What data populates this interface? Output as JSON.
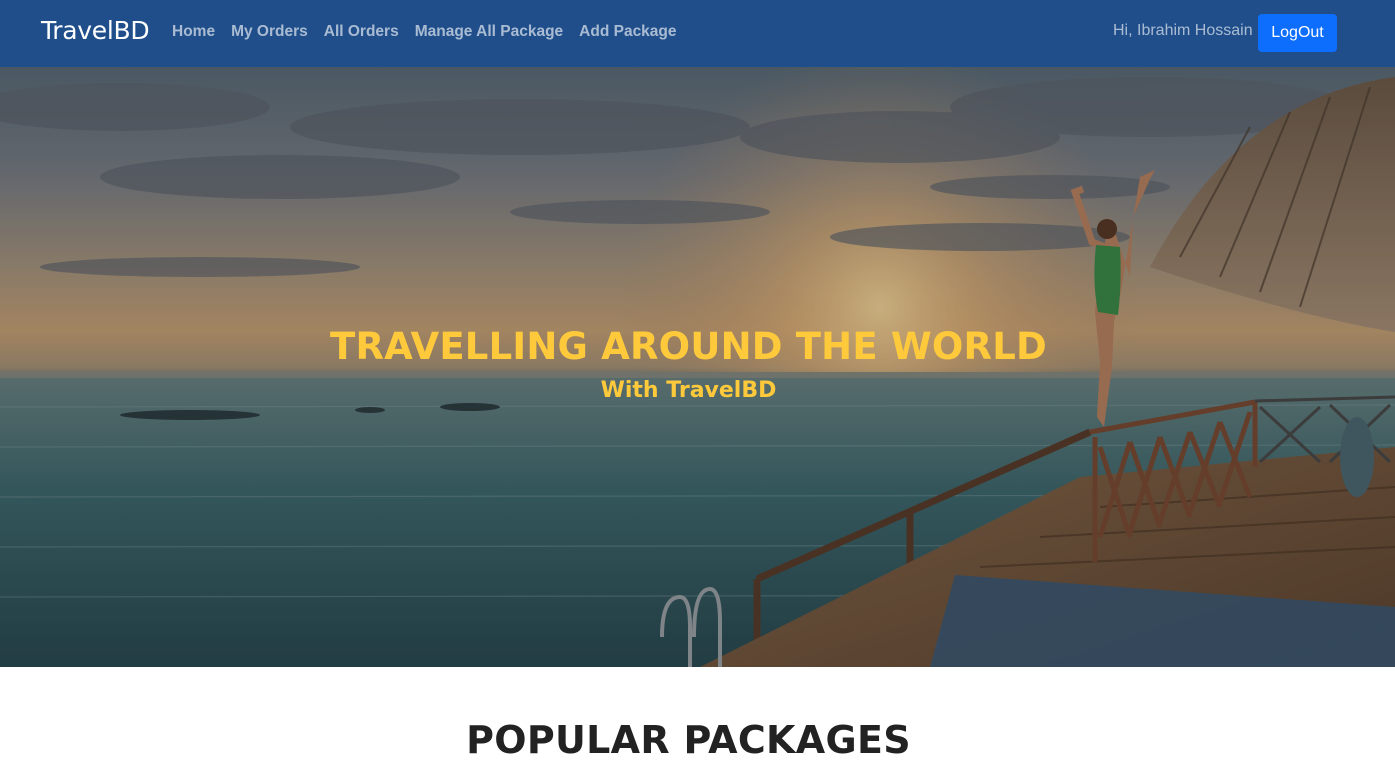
{
  "navbar": {
    "brand": "TravelBD",
    "links": [
      {
        "label": "Home"
      },
      {
        "label": "My Orders"
      },
      {
        "label": "All Orders"
      },
      {
        "label": "Manage All Package"
      },
      {
        "label": "Add Package"
      }
    ],
    "greeting": "Hi, Ibrahim Hossain",
    "logout_label": "LogOut",
    "bg_color": "#1f4e8a",
    "button_color": "#0d6efd"
  },
  "hero": {
    "title": "TRAVELLING AROUND THE WORLD",
    "subtitle": "With TravelBD",
    "accent_color": "#ffc93c",
    "image_subject": "sunset over sea with overwater bungalow deck and woman raising arms"
  },
  "section": {
    "title": "POPULAR PACKAGES"
  }
}
